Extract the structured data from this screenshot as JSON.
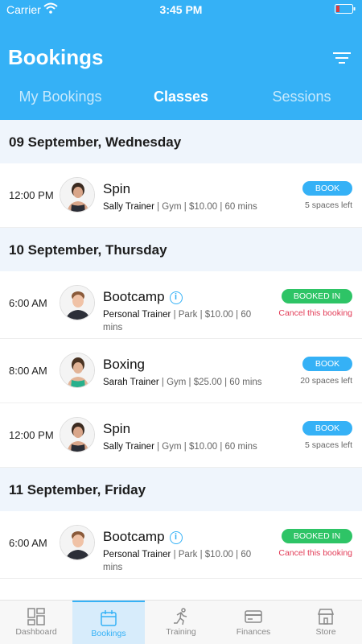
{
  "status": {
    "carrier": "Carrier",
    "time": "3:45 PM"
  },
  "header": {
    "title": "Bookings",
    "tabs": [
      {
        "label": "My Bookings",
        "active": false
      },
      {
        "label": "Classes",
        "active": true
      },
      {
        "label": "Sessions",
        "active": false
      }
    ]
  },
  "days": [
    {
      "date": "09 September, Wednesday",
      "classes": [
        {
          "time": "12:00 PM",
          "name": "Spin",
          "trainer": "Sally Trainer",
          "details": " | Gym | $10.00 | 60 mins",
          "action": "BOOK",
          "note": "5 spaces left",
          "booked": false
        }
      ]
    },
    {
      "date": "10 September, Thursday",
      "classes": [
        {
          "time": "6:00 AM",
          "name": "Bootcamp",
          "trainer": "Personal Trainer",
          "details": " | Park | $10.00 | 60 mins",
          "action": "BOOKED IN",
          "note": "Cancel this booking",
          "booked": true
        },
        {
          "time": "8:00 AM",
          "name": "Boxing",
          "trainer": "Sarah Trainer",
          "details": " | Gym | $25.00 | 60 mins",
          "action": "BOOK",
          "note": "20 spaces left",
          "booked": false
        },
        {
          "time": "12:00 PM",
          "name": "Spin",
          "trainer": "Sally Trainer",
          "details": " | Gym | $10.00 | 60 mins",
          "action": "BOOK",
          "note": "5 spaces left",
          "booked": false
        }
      ]
    },
    {
      "date": "11 September, Friday",
      "classes": [
        {
          "time": "6:00 AM",
          "name": "Bootcamp",
          "trainer": "Personal Trainer",
          "details": " | Park | $10.00 | 60 mins",
          "action": "BOOKED IN",
          "note": "Cancel this booking",
          "booked": true
        }
      ]
    }
  ],
  "nav": [
    {
      "label": "Dashboard",
      "icon": "dashboard-icon",
      "active": false
    },
    {
      "label": "Bookings",
      "icon": "calendar-icon",
      "active": true
    },
    {
      "label": "Training",
      "icon": "running-icon",
      "active": false
    },
    {
      "label": "Finances",
      "icon": "card-icon",
      "active": false
    },
    {
      "label": "Store",
      "icon": "store-icon",
      "active": false
    }
  ],
  "colors": {
    "primary": "#35b1f6",
    "booked": "#2ec466",
    "cancel": "#e23b56",
    "section_bg": "#eff5fc"
  }
}
